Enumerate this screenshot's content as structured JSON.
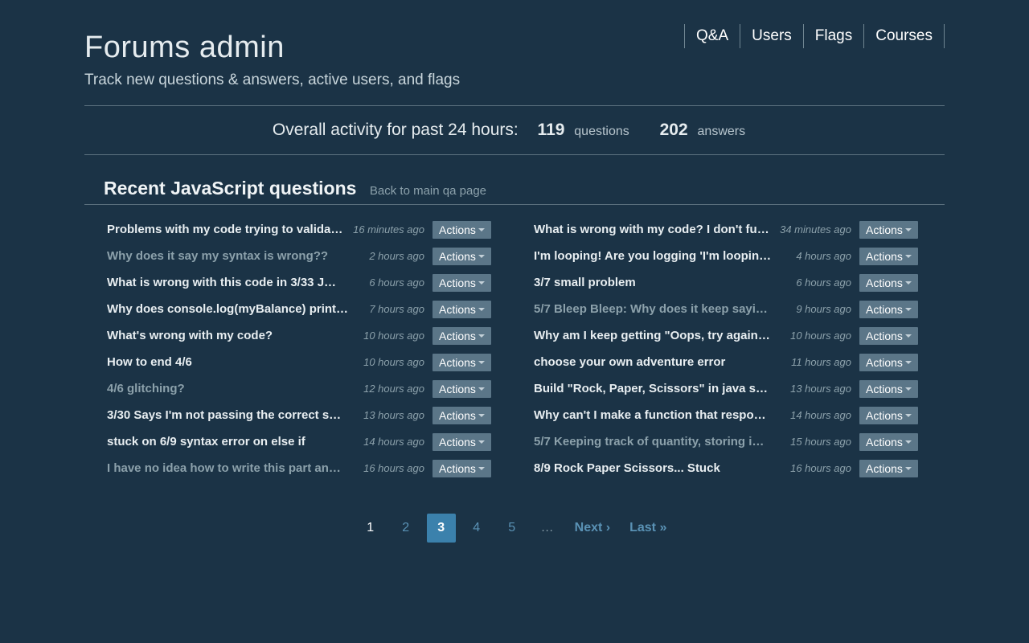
{
  "header": {
    "title": "Forums admin",
    "subtitle": "Track new questions & answers, active users, and flags"
  },
  "nav": {
    "qa": "Q&A",
    "users": "Users",
    "flags": "Flags",
    "courses": "Courses"
  },
  "activity": {
    "label": "Overall activity for past 24 hours:",
    "questions_count": "119",
    "questions_label": "questions",
    "answers_count": "202",
    "answers_label": "answers"
  },
  "section": {
    "heading": "Recent JavaScript questions",
    "back_link": "Back to main qa page"
  },
  "actions_label": "Actions",
  "left": [
    {
      "title": "Problems with my code trying to valida…",
      "time": "16 minutes ago",
      "dim": false
    },
    {
      "title": "Why does it say my syntax is wrong??",
      "time": "2 hours ago",
      "dim": true
    },
    {
      "title": "What is wrong with this code in 3/33 J…",
      "time": "6 hours ago",
      "dim": false
    },
    {
      "title": "Why does console.log(myBalance) print…",
      "time": "7 hours ago",
      "dim": false
    },
    {
      "title": "What's wrong with my code?",
      "time": "10 hours ago",
      "dim": false
    },
    {
      "title": "How to end 4/6",
      "time": "10 hours ago",
      "dim": false
    },
    {
      "title": "4/6 glitching?",
      "time": "12 hours ago",
      "dim": true
    },
    {
      "title": "3/30 Says I'm not passing the correct s…",
      "time": "13 hours ago",
      "dim": false
    },
    {
      "title": "stuck on 6/9 syntax error on else if",
      "time": "14 hours ago",
      "dim": false
    },
    {
      "title": "I have no idea how to write this part an…",
      "time": "16 hours ago",
      "dim": true
    }
  ],
  "right": [
    {
      "title": "What is wrong with my code? I don't fu…",
      "time": "34 minutes ago",
      "dim": false
    },
    {
      "title": "I'm looping! Are you logging 'I'm loopin…",
      "time": "4 hours ago",
      "dim": false
    },
    {
      "title": "3/7 small problem",
      "time": "6 hours ago",
      "dim": false
    },
    {
      "title": "5/7 Bleep Bleep: Why does it keep sayi…",
      "time": "9 hours ago",
      "dim": true
    },
    {
      "title": "Why am I keep getting \"Oops, try again…",
      "time": "10 hours ago",
      "dim": false
    },
    {
      "title": "choose your own adventure error",
      "time": "11 hours ago",
      "dim": false
    },
    {
      "title": "Build \"Rock, Paper, Scissors\" in java s…",
      "time": "13 hours ago",
      "dim": false
    },
    {
      "title": "Why can't I make a function that respo…",
      "time": "14 hours ago",
      "dim": false
    },
    {
      "title": "5/7 Keeping track of quantity, storing i…",
      "time": "15 hours ago",
      "dim": true
    },
    {
      "title": "8/9 Rock Paper Scissors... Stuck",
      "time": "16 hours ago",
      "dim": false
    }
  ],
  "pager": {
    "p1": "1",
    "p2": "2",
    "p3": "3",
    "p4": "4",
    "p5": "5",
    "ellipsis": "…",
    "next": "Next ›",
    "last": "Last »"
  }
}
